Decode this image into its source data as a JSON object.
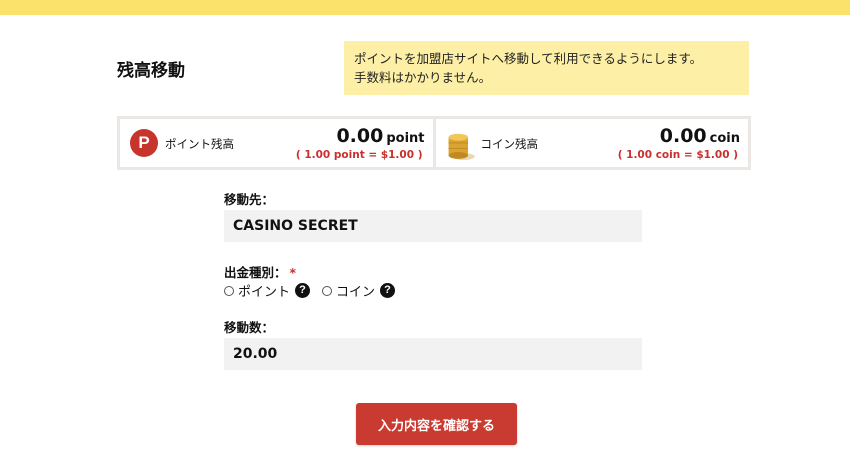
{
  "page_title": "残高移動",
  "info": {
    "line1": "ポイントを加盟店サイトへ移動して利用できるようにします。",
    "line2": "手数料はかかりません。"
  },
  "balances": {
    "point": {
      "icon_letter": "P",
      "label": "ポイント残高",
      "value": "0.00",
      "unit": "point",
      "rate": "( 1.00 point = $1.00 )"
    },
    "coin": {
      "label": "コイン残高",
      "value": "0.00",
      "unit": "coin",
      "rate": "( 1.00 coin = $1.00 )"
    }
  },
  "form": {
    "destination_label": "移動先：",
    "destination_value": "CASINO SECRET",
    "withdraw_type_label": "出金種別：",
    "required_mark": "*",
    "options": [
      {
        "label": "ポイント",
        "help": "?"
      },
      {
        "label": "コイン",
        "help": "?"
      }
    ],
    "amount_label": "移動数：",
    "amount_value": "20.00",
    "submit_label": "入力内容を確認する"
  },
  "colors": {
    "top_bar": "#fbe26a",
    "info_bg": "#fdf0a6",
    "accent_red": "#c93a30"
  }
}
